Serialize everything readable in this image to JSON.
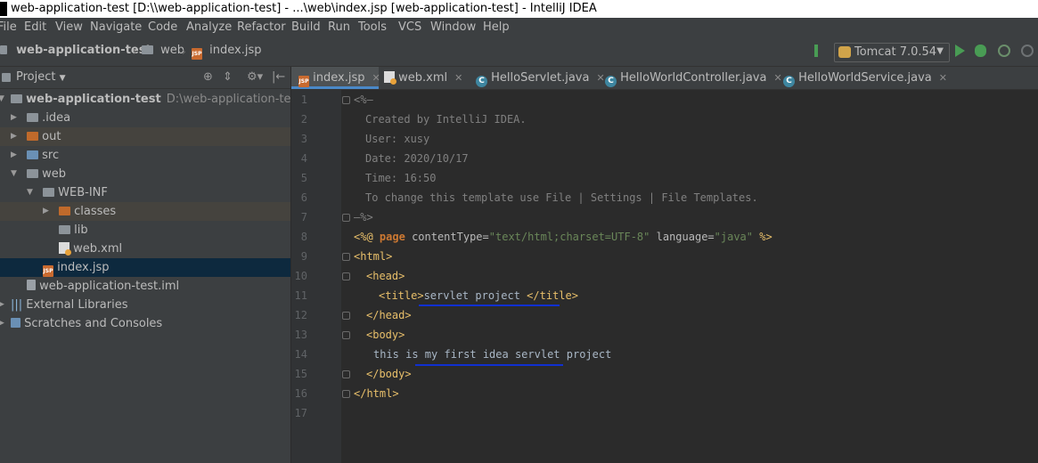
{
  "window": {
    "title": "web-application-test [D:\\\\web-application-test] - ...\\web\\index.jsp [web-application-test] - IntelliJ IDEA"
  },
  "menu": [
    "File",
    "Edit",
    "View",
    "Navigate",
    "Code",
    "Analyze",
    "Refactor",
    "Build",
    "Run",
    "Tools",
    "VCS",
    "Window",
    "Help"
  ],
  "breadcrumb": {
    "project": "web-application-test",
    "folder": "web",
    "file": "index.jsp"
  },
  "run_config": {
    "label": "Tomcat 7.0.54"
  },
  "sidebar": {
    "title": "Project",
    "tree": [
      {
        "label": "web-application-test",
        "sub": "D:\\web-application-test"
      },
      {
        "label": ".idea"
      },
      {
        "label": "out"
      },
      {
        "label": "src"
      },
      {
        "label": "web"
      },
      {
        "label": "WEB-INF"
      },
      {
        "label": "classes"
      },
      {
        "label": "lib"
      },
      {
        "label": "web.xml"
      },
      {
        "label": "index.jsp"
      },
      {
        "label": "web-application-test.iml"
      },
      {
        "label": "External Libraries"
      },
      {
        "label": "Scratches and Consoles"
      }
    ]
  },
  "tabs": [
    "index.jsp",
    "web.xml",
    "HelloServlet.java",
    "HelloWorldController.java",
    "HelloWorldService.java"
  ],
  "code": {
    "line_numbers": [
      "1",
      "2",
      "3",
      "4",
      "5",
      "6",
      "7",
      "8",
      "9",
      "10",
      "11",
      "12",
      "13",
      "14",
      "15",
      "16",
      "17"
    ],
    "l1": "<%—",
    "l2": "Created by IntelliJ IDEA.",
    "l3": "User: xusy",
    "l4": "Date: 2020/10/17",
    "l5": "Time: 16:50",
    "l6": "To change this template use File | Settings | File Templates.",
    "l7": "—%>",
    "l8_open": "<%@",
    "l8_kw": "page",
    "l8_attr1": "contentType=",
    "l8_val1": "\"text/html;charset=UTF-8\"",
    "l8_attr2": "language=",
    "l8_val2": "\"java\"",
    "l8_close": "%>",
    "l9": "<html>",
    "l10": "<head>",
    "l11_open": "<title>",
    "l11_text": "servlet project ",
    "l11_close": "</title>",
    "l12": "</head>",
    "l13": "<body>",
    "l14": "this is my first idea servlet project",
    "l15": "</body>",
    "l16": "</html>"
  }
}
